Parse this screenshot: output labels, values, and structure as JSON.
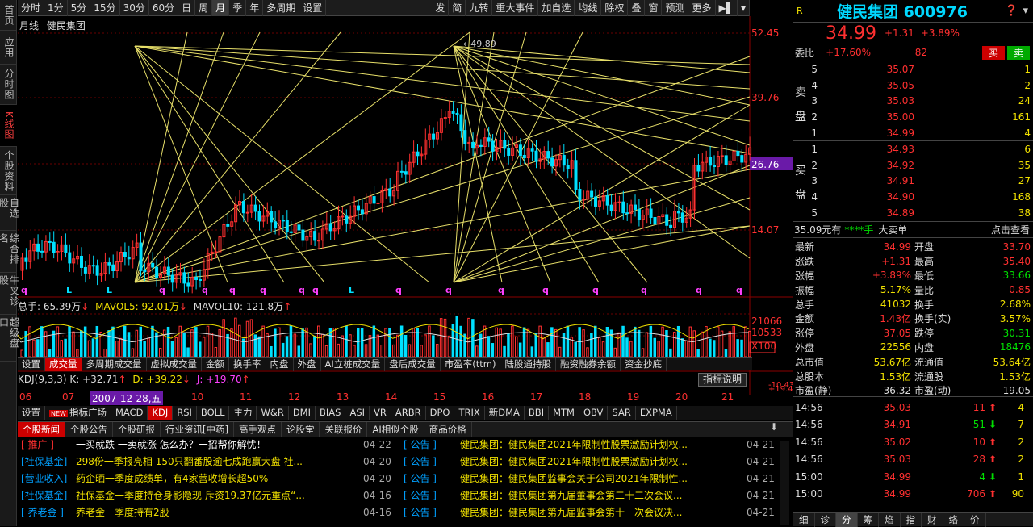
{
  "sidebar": [
    {
      "label": "首页",
      "active": false
    },
    {
      "label": "应用",
      "active": false
    },
    {
      "label": "分时图",
      "active": false
    },
    {
      "label": "K线图",
      "active": true
    },
    {
      "label": "个股资料",
      "active": false
    },
    {
      "label": "自选股",
      "active": false
    },
    {
      "label": "综合排名",
      "active": false
    },
    {
      "label": "牛叉诊股",
      "active": false
    },
    {
      "label": "超级盘口",
      "active": false
    }
  ],
  "toolbar": [
    "分时",
    "1分",
    "5分",
    "15分",
    "30分",
    "60分",
    "日",
    "周",
    "月",
    "季",
    "年",
    "多周期",
    "设置"
  ],
  "toolbar_active": "月",
  "toolbar_right": [
    "发",
    "简",
    "九转",
    "重大事件",
    "加自选",
    "均线",
    "除权",
    "叠",
    "窗",
    "预测",
    "更多"
  ],
  "chart": {
    "period_label": "月线",
    "stock_name": "健民集团",
    "high_mark": "49.89",
    "price_scale": [
      "52.45",
      "39.76",
      "26.76",
      "14.07"
    ],
    "current_price_tag": "26.76",
    "volume_header": {
      "total": "总手: 65.39万",
      "mavol5": "MAVOL5: 92.01万",
      "mavol10": "MAVOL10: 121.8万"
    },
    "vol_scale": [
      "21066",
      "10533",
      "X100"
    ],
    "kdj": {
      "label": "KDJ(9,3,3)",
      "k": "K: +32.71",
      "d": "D: +39.22",
      "j": "J: +19.70"
    },
    "kdj_scale": [
      "-10.43",
      "+19.43"
    ],
    "year_labels": [
      "06",
      "07",
      "2007-12-28,五",
      "10",
      "11",
      "12",
      "13",
      "14",
      "15",
      "16",
      "17",
      "18",
      "19",
      "20",
      "21"
    ],
    "bottom_markers": [
      "q",
      "L",
      "L",
      "q",
      "q",
      "q",
      "q",
      "q",
      "q",
      "L",
      "q",
      "q",
      "q",
      "q",
      "q",
      "q",
      "q",
      "q"
    ]
  },
  "bottom_tabs": [
    "设置",
    "成交量",
    "多周期成交量",
    "虚拟成交量",
    "金额",
    "换手率",
    "内盘",
    "外盘",
    "AI立桩成交量",
    "盘后成交量",
    "市盈率(ttm)",
    "陆股通持股",
    "融资融券余额",
    "资金抄底"
  ],
  "bottom_tabs_active": "成交量",
  "indicator_explain": "指标说明",
  "indicator_tabs": [
    "设置",
    "指标广场",
    "MACD",
    "KDJ",
    "RSI",
    "BOLL",
    "主力",
    "W&R",
    "DMI",
    "BIAS",
    "ASI",
    "VR",
    "ARBR",
    "DPO",
    "TRIX",
    "新DMA",
    "BBI",
    "MTM",
    "OBV",
    "SAR",
    "EXPMA"
  ],
  "indicator_active": "KDJ",
  "news_tabs": [
    "个股新闻",
    "个股公告",
    "个股研报",
    "行业资讯[中药]",
    "高手观点",
    "论股堂",
    "关联报价",
    "AI相似个股",
    "商品价格"
  ],
  "news_active": "个股新闻",
  "news_left": [
    {
      "tag": "[  推广  ]",
      "title": "一买就跌 一卖就涨 怎么办？一招帮你解忧！",
      "date": "04-22",
      "tagcolor": "#ff3030",
      "titlecolor": "#ffffff"
    },
    {
      "tag": "[社保基金]",
      "title": "298份一季报亮相 150只翻番股逾七成跑赢大盘 社...",
      "date": "04-20",
      "tagcolor": "#00a0ff",
      "titlecolor": "#f0e000"
    },
    {
      "tag": "[营业收入]",
      "title": "药企晒一季度成绩单，有4家营收增长超50%",
      "date": "04-20",
      "tagcolor": "#00a0ff",
      "titlecolor": "#f0e000"
    },
    {
      "tag": "[社保基金]",
      "title": "社保基金一季度持仓身影隐现 斥资19.37亿元重点“...",
      "date": "04-16",
      "tagcolor": "#00a0ff",
      "titlecolor": "#f0e000"
    },
    {
      "tag": "[ 养老金 ]",
      "title": "养老金一季度持有2股",
      "date": "04-16",
      "tagcolor": "#00a0ff",
      "titlecolor": "#f0e000"
    }
  ],
  "news_right": [
    {
      "tag": "[  公告  ]",
      "title": "健民集团：健民集团2021年限制性股票激励计划权...",
      "date": "04-21"
    },
    {
      "tag": "[  公告  ]",
      "title": "健民集团：健民集团2021年限制性股票激励计划权...",
      "date": "04-21"
    },
    {
      "tag": "[  公告  ]",
      "title": "健民集团：健民集团监事会关于公司2021年限制性...",
      "date": "04-21"
    },
    {
      "tag": "[  公告  ]",
      "title": "健民集团：健民集团第九届董事会第二十二次会议...",
      "date": "04-21"
    },
    {
      "tag": "[  公告  ]",
      "title": "健民集团：健民集团第九届监事会第十一次会议决...",
      "date": "04-21"
    }
  ],
  "quote": {
    "r_badge": "R",
    "name_code": "健民集团 600976",
    "price": "34.99",
    "change": "+1.31",
    "pct": "+3.89%",
    "weibi_label": "委比",
    "weibi": "+17.60%",
    "weicha": "82",
    "sell_btn": "买",
    "buy_btn": "卖",
    "sell_label": "卖盘",
    "buy_label": "买盘",
    "asks": [
      {
        "n": "5",
        "p": "35.07",
        "v": "1"
      },
      {
        "n": "4",
        "p": "35.05",
        "v": "2"
      },
      {
        "n": "3",
        "p": "35.03",
        "v": "24"
      },
      {
        "n": "2",
        "p": "35.00",
        "v": "161"
      },
      {
        "n": "1",
        "p": "34.99",
        "v": "4"
      }
    ],
    "bids": [
      {
        "n": "1",
        "p": "34.93",
        "v": "6"
      },
      {
        "n": "2",
        "p": "34.92",
        "v": "35"
      },
      {
        "n": "3",
        "p": "34.91",
        "v": "27"
      },
      {
        "n": "4",
        "p": "34.90",
        "v": "168"
      },
      {
        "n": "5",
        "p": "34.89",
        "v": "38"
      }
    ],
    "big_order": {
      "price": "35.09元有",
      "qty": "****手",
      "label": "大卖单",
      "link": "点击查看"
    },
    "stats_left": [
      [
        "最新",
        "34.99"
      ],
      [
        "涨跌",
        "+1.31"
      ],
      [
        "涨幅",
        "+3.89%"
      ],
      [
        "振幅",
        "5.17%"
      ],
      [
        "总手",
        "41032"
      ],
      [
        "金额",
        "1.43亿"
      ],
      [
        "涨停",
        "37.05"
      ],
      [
        "外盘",
        "22556"
      ],
      [
        "总市值",
        "53.67亿"
      ],
      [
        "总股本",
        "1.53亿"
      ],
      [
        "市盈(静)",
        "36.32"
      ]
    ],
    "stats_right": [
      [
        "开盘",
        "33.70"
      ],
      [
        "最高",
        "35.40"
      ],
      [
        "最低",
        "33.66"
      ],
      [
        "量比",
        "0.85"
      ],
      [
        "换手",
        "2.68%"
      ],
      [
        "换手(实)",
        "3.57%"
      ],
      [
        "跌停",
        "30.31"
      ],
      [
        "内盘",
        "18476"
      ],
      [
        "流通值",
        "53.64亿"
      ],
      [
        "流通股",
        "1.53亿"
      ],
      [
        "市盈(动)",
        "19.05"
      ]
    ],
    "ticks": [
      {
        "t": "14:56",
        "p": "35.03",
        "v": "11",
        "d": "up",
        "c": "4"
      },
      {
        "t": "14:56",
        "p": "34.91",
        "v": "51",
        "d": "down",
        "c": "7"
      },
      {
        "t": "14:56",
        "p": "35.02",
        "v": "10",
        "d": "up",
        "c": "2"
      },
      {
        "t": "14:56",
        "p": "35.03",
        "v": "28",
        "d": "up",
        "c": "2"
      },
      {
        "t": "15:00",
        "p": "34.99",
        "v": "4",
        "d": "down",
        "c": "1"
      },
      {
        "t": "15:00",
        "p": "34.99",
        "v": "706",
        "d": "up",
        "c": "90"
      }
    ],
    "bottom_tabs": [
      "细",
      "诊",
      "分",
      "筹",
      "焰",
      "指",
      "财",
      "络",
      "价"
    ],
    "bottom_active": "分"
  }
}
